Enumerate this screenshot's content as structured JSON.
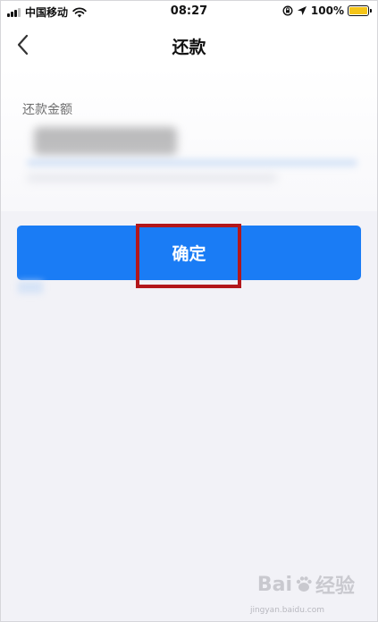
{
  "status_bar": {
    "carrier": "中国移动",
    "time": "08:27",
    "battery": "100%",
    "icons": [
      "signal-icon",
      "wifi-icon",
      "rotation-lock-icon",
      "location-icon",
      "battery-icon"
    ]
  },
  "nav": {
    "title": "还款",
    "back_icon": "chevron-left-icon"
  },
  "card": {
    "amount_label": "还款金额"
  },
  "confirm": {
    "label": "确定"
  },
  "watermark": {
    "brand": "Bai",
    "brand2": "经验",
    "url": "jingyan.baidu.com"
  },
  "colors": {
    "primary": "#1a7cf5",
    "highlight": "#b3171b",
    "background": "#f2f2f7",
    "battery": "#f5c518"
  }
}
